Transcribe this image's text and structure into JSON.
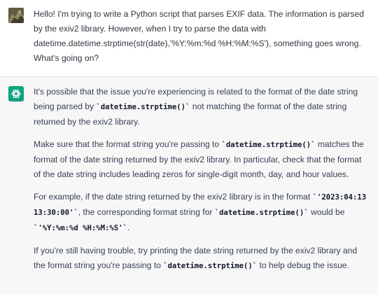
{
  "user_message": {
    "text": "Hello! I'm trying to write a Python script that parses EXIF data. The information is parsed by the exiv2 library. However, when I try to parse the data with datetime.datetime.strptime(str(date),'%Y:%m:%d %H:%M:%S'), something goes wrong. What's going on?"
  },
  "assistant_message": {
    "p1": {
      "t1": "It's possible that the issue you're experiencing is related to the format of the date string being parsed by ",
      "c1": "`datetime.strptime()`",
      "t2": " not matching the format of the date string returned by the exiv2 library."
    },
    "p2": {
      "t1": "Make sure that the format string you're passing to ",
      "c1": "`datetime.strptime()`",
      "t2": " matches the format of the date string returned by the exiv2 library. In particular, check that the format of the date string includes leading zeros for single-digit month, day, and hour values."
    },
    "p3": {
      "t1": "For example, if the date string returned by the exiv2 library is in the format ",
      "c1": "`'2023:04:13 13:30:00'`",
      "t2": ", the corresponding format string for ",
      "c2": "`datetime.strptime()`",
      "t3": " would be ",
      "c3": "`'%Y:%m:%d %H:%M:%S'`",
      "t4": "."
    },
    "p4": {
      "t1": "If you're still having trouble, try printing the date string returned by the exiv2 library and the format string you're passing to ",
      "c1": "`datetime.strptime()`",
      "t2": " to help debug the issue."
    }
  },
  "icons": {
    "user_avatar": "user-avatar-photo",
    "assistant_avatar": "openai-logo"
  },
  "colors": {
    "assistant_bg": "#f7f7f8",
    "assistant_avatar_bg": "#10a37f"
  }
}
